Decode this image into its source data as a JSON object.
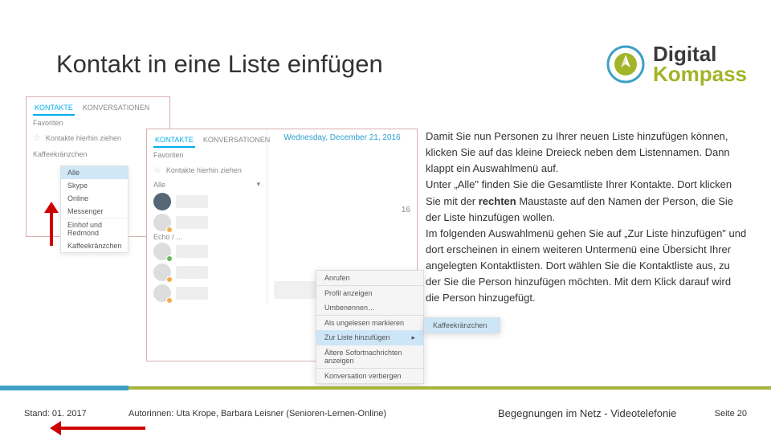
{
  "header": {
    "title": "Kontakt in eine Liste einfügen",
    "logo": {
      "digital": "Digital",
      "kompass": "Kompass"
    }
  },
  "win1": {
    "tab_contacts": "KONTAKTE",
    "tab_conv": "KONVERSATIONEN",
    "favorites": "Favoriten",
    "drag_here": "Kontakte hierhin ziehen",
    "list_name": "Kaffeekränzchen",
    "dropdown": {
      "all": "Alle",
      "skype": "Skype",
      "online": "Online",
      "messenger": "Messenger",
      "sep": "Einhof und Redmond",
      "list": "Kaffeekränzchen"
    }
  },
  "win2": {
    "tab_contacts": "KONTAKTE",
    "tab_conv": "KONVERSATIONEN",
    "favorites": "Favoriten",
    "drag_here": "Kontakte hierhin ziehen",
    "all": "Alle",
    "date": "Wednesday, December 21, 2016",
    "count": "16",
    "echo": "Echo / …",
    "ctx": {
      "call": "Anrufen",
      "profile": "Profil anzeigen",
      "rename": "Umbenennen…",
      "mark_unread": "Als ungelesen markieren",
      "add_to_list": "Zur Liste hinzufügen",
      "old_msgs": "Ältere Sofortnachrichten anzeigen",
      "hide": "Konversation verbergen"
    },
    "sub": {
      "list": "Kaffeekränzchen"
    }
  },
  "body": "Damit Sie nun Personen zu Ihrer neuen Liste hinzufügen können, klicken Sie auf das kleine Dreieck neben dem Listennamen. Dann klappt ein Auswahlmenü auf.\nUnter „Alle\" finden Sie die Gesamtliste Ihrer Kontakte. Dort klicken Sie mit der rechten Maustaste auf den Namen der Person, die Sie der Liste hinzufügen wollen.\nIm folgenden Auswahlmenü gehen Sie auf „Zur Liste hinzufügen\" und dort erscheinen in einem weiteren Untermenü eine Übersicht Ihrer angelegten Kontaktlisten. Dort wählen Sie die Kontaktliste aus, zu der Sie die Person hinzufügen möchten. Mit dem Klick darauf wird die Person hinzugefügt.",
  "body_bold": "rechten",
  "footer": {
    "stand": "Stand: 01. 2017",
    "autor": "Autorinnen: Uta Krope, Barbara Leisner (Senioren-Lernen-Online)",
    "title": "Begegnungen im Netz - Videotelefonie",
    "page": "Seite 20"
  }
}
